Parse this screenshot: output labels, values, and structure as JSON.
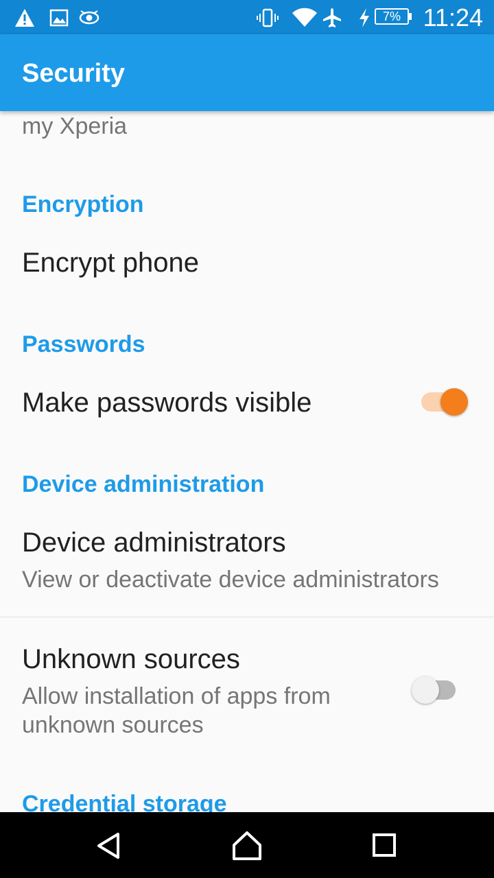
{
  "status_bar": {
    "time": "11:24",
    "battery": "7%",
    "icons": [
      "warning-icon",
      "image-icon",
      "eye-icon",
      "vibrate-icon",
      "wifi-icon",
      "airplane-icon",
      "charging-icon",
      "battery-icon"
    ]
  },
  "app_bar": {
    "title": "Security"
  },
  "content": {
    "truncated_text": "my Xperia",
    "encryption": {
      "header": "Encryption",
      "encrypt_phone": "Encrypt phone"
    },
    "passwords": {
      "header": "Passwords",
      "make_visible": "Make passwords visible",
      "make_visible_on": true
    },
    "device_admin": {
      "header": "Device administration",
      "administrators_title": "Device administrators",
      "administrators_summary": "View or deactivate device administrators",
      "unknown_title": "Unknown sources",
      "unknown_summary_line1": "Allow installation of apps from",
      "unknown_summary_line2": "unknown sources",
      "unknown_on": false
    },
    "credential_storage": {
      "header": "Credential storage"
    }
  },
  "colors": {
    "status_bar": "#1186d2",
    "app_bar": "#1e9be8",
    "accent": "#1e9be8",
    "switch_on": "#f47e1b"
  },
  "nav_bar": {
    "icons": [
      "back-icon",
      "home-icon",
      "recents-icon"
    ]
  }
}
